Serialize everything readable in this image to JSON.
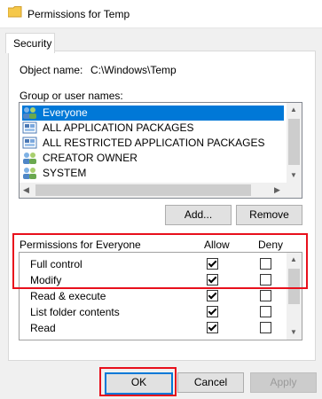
{
  "window": {
    "title": "Permissions for Temp"
  },
  "tabs": [
    {
      "label": "Security"
    }
  ],
  "object": {
    "label": "Object name:",
    "value": "C:\\Windows\\Temp"
  },
  "group": {
    "label": "Group or user names:",
    "items": [
      {
        "label": "Everyone",
        "icon": "users-icon",
        "selected": true
      },
      {
        "label": "ALL APPLICATION PACKAGES",
        "icon": "package-icon",
        "selected": false
      },
      {
        "label": "ALL RESTRICTED APPLICATION PACKAGES",
        "icon": "package-icon",
        "selected": false
      },
      {
        "label": "CREATOR OWNER",
        "icon": "users-icon",
        "selected": false
      },
      {
        "label": "SYSTEM",
        "icon": "users-icon",
        "selected": false
      }
    ]
  },
  "buttons": {
    "add": "Add...",
    "remove": "Remove",
    "ok": "OK",
    "cancel": "Cancel",
    "apply": "Apply"
  },
  "permissions": {
    "header": "Permissions for Everyone",
    "allow_label": "Allow",
    "deny_label": "Deny",
    "rows": [
      {
        "name": "Full control",
        "allow": true,
        "deny": false
      },
      {
        "name": "Modify",
        "allow": true,
        "deny": false
      },
      {
        "name": "Read & execute",
        "allow": true,
        "deny": false
      },
      {
        "name": "List folder contents",
        "allow": true,
        "deny": false
      },
      {
        "name": "Read",
        "allow": true,
        "deny": false
      }
    ]
  },
  "colors": {
    "selection": "#0078d7",
    "highlight_box": "#e8101c"
  }
}
